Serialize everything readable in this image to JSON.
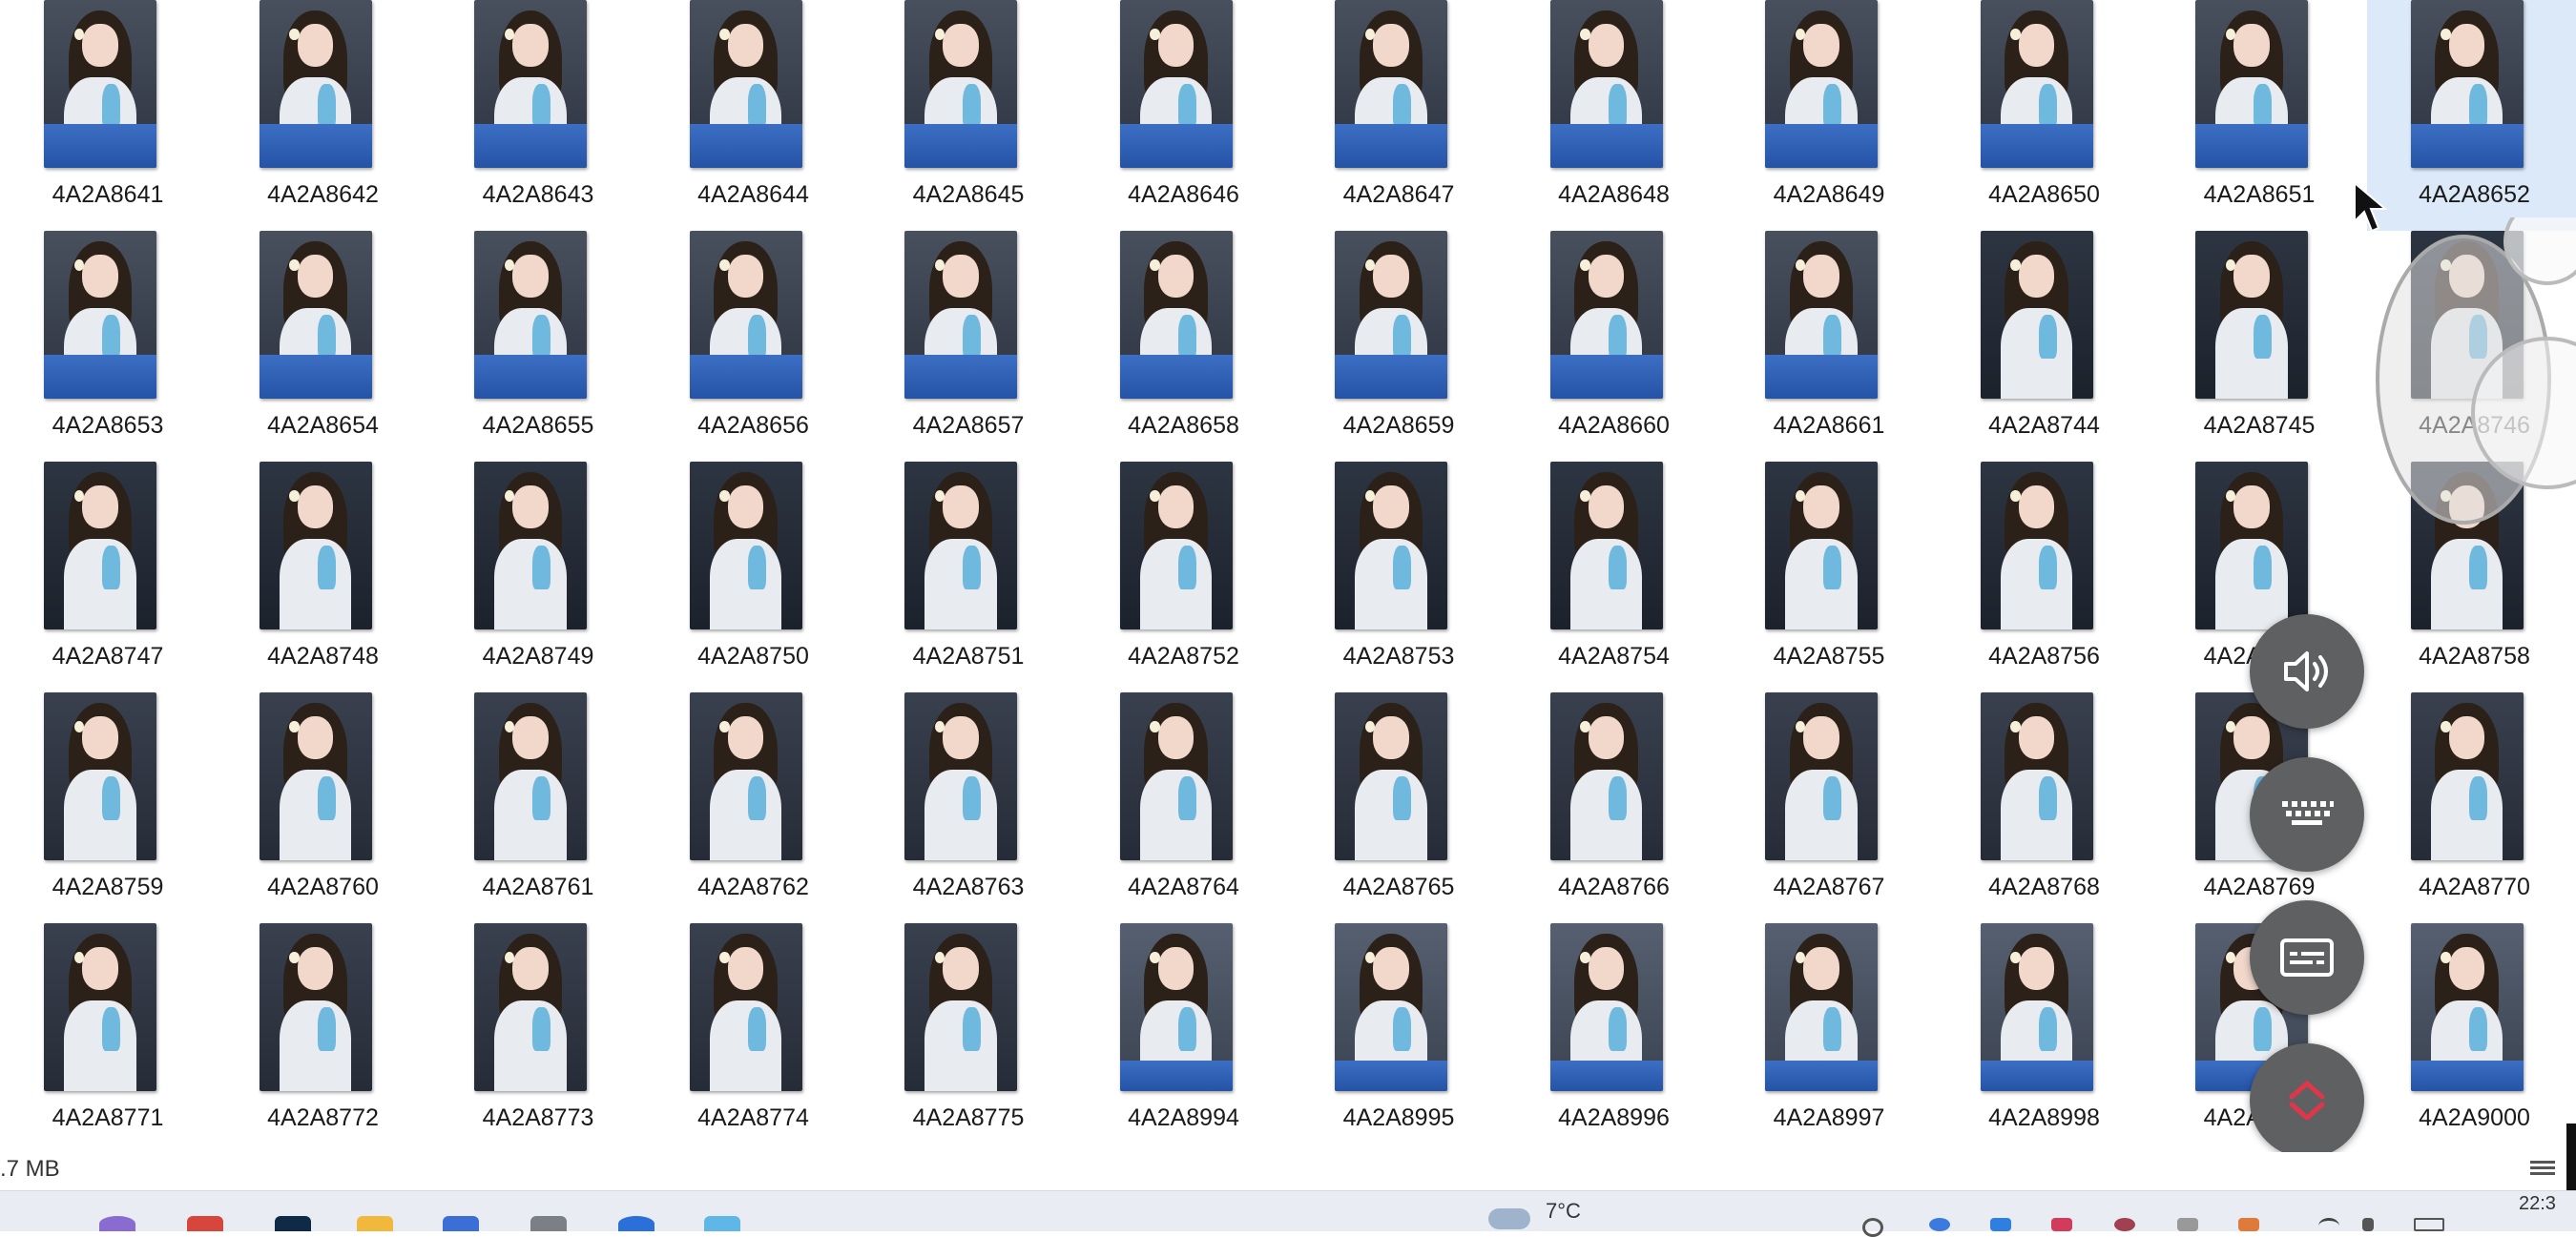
{
  "files": [
    "4A2A8641",
    "4A2A8642",
    "4A2A8643",
    "4A2A8644",
    "4A2A8645",
    "4A2A8646",
    "4A2A8647",
    "4A2A8648",
    "4A2A8649",
    "4A2A8650",
    "4A2A8651",
    "4A2A8652",
    "4A2A8653",
    "4A2A8654",
    "4A2A8655",
    "4A2A8656",
    "4A2A8657",
    "4A2A8658",
    "4A2A8659",
    "4A2A8660",
    "4A2A8661",
    "4A2A8744",
    "4A2A8745",
    "4A2A8746",
    "4A2A8747",
    "4A2A8748",
    "4A2A8749",
    "4A2A8750",
    "4A2A8751",
    "4A2A8752",
    "4A2A8753",
    "4A2A8754",
    "4A2A8755",
    "4A2A8756",
    "4A2A8757",
    "4A2A8758",
    "4A2A8759",
    "4A2A8760",
    "4A2A8761",
    "4A2A8762",
    "4A2A8763",
    "4A2A8764",
    "4A2A8765",
    "4A2A8766",
    "4A2A8767",
    "4A2A8768",
    "4A2A8769",
    "4A2A8770",
    "4A2A8771",
    "4A2A8772",
    "4A2A8773",
    "4A2A8774",
    "4A2A8775",
    "4A2A8994",
    "4A2A8995",
    "4A2A8996",
    "4A2A8997",
    "4A2A8998",
    "4A2A8999",
    "4A2A9000"
  ],
  "selected_file": "4A2A8652",
  "status_bar": {
    "size_text": ".7 MB"
  },
  "taskbar": {
    "weather_temp": "7°C",
    "clock": "22:3",
    "pinned_icons": [
      "search-icon",
      "game-icon",
      "photoshop-icon",
      "folder-icon",
      "mail-icon",
      "camera-icon",
      "browser-icon",
      "store-icon"
    ],
    "tray_icons": [
      "refresh-icon",
      "chrome-icon",
      "lock-icon",
      "pinterest-icon",
      "user-icon",
      "settings-icon",
      "app-icon",
      "wifi-icon",
      "volume-icon",
      "battery-icon"
    ]
  },
  "floating_controls": [
    "volume-button",
    "keyboard-button",
    "subtitle-button",
    "collapse-button"
  ],
  "colors": {
    "selection": "#dce9f8",
    "float_button": "#5f6062",
    "taskbar": "#e9edf3"
  }
}
